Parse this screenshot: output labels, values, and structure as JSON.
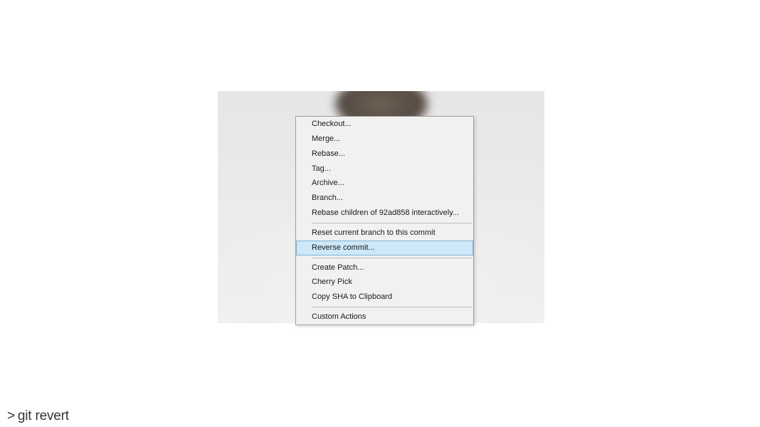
{
  "menu": {
    "items": {
      "checkout": "Checkout...",
      "merge": "Merge...",
      "rebase": "Rebase...",
      "tag": "Tag...",
      "archive": "Archive...",
      "branch": "Branch...",
      "rebase_children": "Rebase children of 92ad858 interactively...",
      "reset_current": "Reset current branch to this commit",
      "reverse_commit": "Reverse commit...",
      "create_patch": "Create Patch...",
      "cherry_pick": "Cherry Pick",
      "copy_sha": "Copy SHA to Clipboard",
      "custom_actions": "Custom Actions"
    },
    "highlighted": "reverse_commit"
  },
  "caption": {
    "prompt": ">",
    "text": "git revert"
  }
}
